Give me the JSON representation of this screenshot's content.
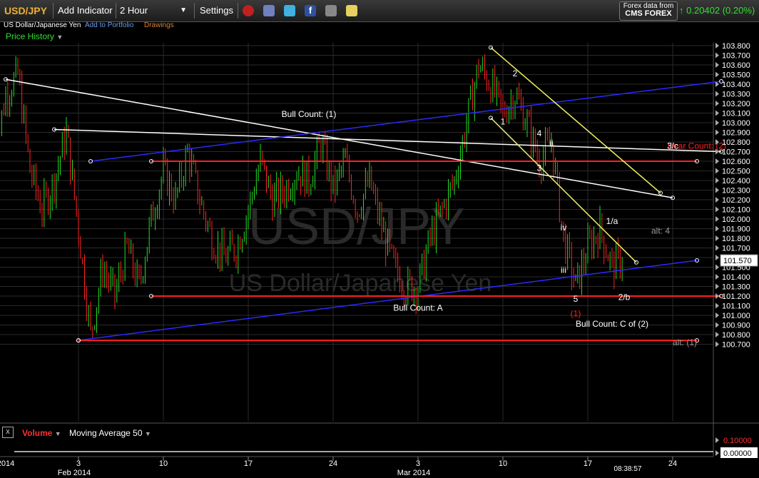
{
  "toolbar": {
    "symbol": "USD/JPY",
    "add_indicator": "Add Indicator",
    "interval": "2 Hour",
    "settings": "Settings",
    "provider_line1": "Forex data from",
    "provider_line2": "CMS FOREX",
    "change": "0.20402 (0.20%)",
    "up_arrow": "↑"
  },
  "subbar": {
    "name": "US Dollar/Japanese Yen",
    "portfolio": "Add to Portfolio",
    "drawings": "Drawings"
  },
  "price_history": "Price History",
  "volume_panel": {
    "close": "x",
    "volume": "Volume",
    "moving_average": "Moving Average 50"
  },
  "colors": {
    "up": "#22dd22",
    "down": "#ff2222",
    "blue_line": "#2a2aff",
    "red_line": "#ff2020",
    "yellow_line": "#f0f060",
    "white_line": "#ffffff",
    "grid": "#2a2a2a"
  },
  "icons": [
    "alarm-clock-icon",
    "cube-icon",
    "twitter-icon",
    "facebook-icon",
    "binoculars-icon",
    "note-icon"
  ],
  "chart_data": {
    "type": "candlestick",
    "watermark_symbol": "USD/JPY",
    "watermark_name": "US Dollar/Japanese Yen",
    "ylim": [
      100.6,
      103.9
    ],
    "y_ticks": [
      "103.800",
      "103.700",
      "103.600",
      "103.500",
      "103.400",
      "103.300",
      "103.200",
      "103.100",
      "103.000",
      "102.900",
      "102.800",
      "102.700",
      "102.600",
      "102.500",
      "102.400",
      "102.300",
      "102.200",
      "102.100",
      "102.000",
      "101.900",
      "101.800",
      "101.700",
      "101.600",
      "101.500",
      "101.400",
      "101.300",
      "101.200",
      "101.100",
      "101.000",
      "100.900",
      "100.800",
      "100.700"
    ],
    "last_price": "101.570",
    "volume_ticks": [
      "0.10000",
      "0.00000"
    ],
    "time_label": "08:38:57",
    "x_ticks": [
      {
        "label": "2014",
        "date": "2014-01-27"
      },
      {
        "label": "3",
        "date": "2014-02-03"
      },
      {
        "label": "10",
        "date": "2014-02-10"
      },
      {
        "label": "17",
        "date": "2014-02-17"
      },
      {
        "label": "24",
        "date": "2014-02-24"
      },
      {
        "label": "3",
        "date": "2014-03-03"
      },
      {
        "label": "10",
        "date": "2014-03-10"
      },
      {
        "label": "17",
        "date": "2014-03-17"
      },
      {
        "label": "24",
        "date": "2014-03-24"
      }
    ],
    "x_month_labels": [
      {
        "label": "Feb 2014",
        "date": "2014-02-03"
      },
      {
        "label": "Mar 2014",
        "date": "2014-03-03"
      }
    ],
    "price_path": [
      [
        "2014-01-27",
        102.6
      ],
      [
        "2014-01-28",
        103.3
      ],
      [
        "2014-01-29",
        103.5
      ],
      [
        "2014-01-30",
        102.5
      ],
      [
        "2014-01-31",
        102.1
      ],
      [
        "2014-02-01",
        102.4
      ],
      [
        "2014-02-02",
        102.9
      ],
      [
        "2014-02-03",
        101.9
      ],
      [
        "2014-02-04",
        100.8
      ],
      [
        "2014-02-05",
        101.5
      ],
      [
        "2014-02-06",
        101.2
      ],
      [
        "2014-02-07",
        101.7
      ],
      [
        "2014-02-08",
        101.3
      ],
      [
        "2014-02-09",
        102.0
      ],
      [
        "2014-02-10",
        102.5
      ],
      [
        "2014-02-11",
        102.2
      ],
      [
        "2014-02-12",
        102.7
      ],
      [
        "2014-02-13",
        102.2
      ],
      [
        "2014-02-14",
        101.8
      ],
      [
        "2014-02-15",
        101.6
      ],
      [
        "2014-02-16",
        101.7
      ],
      [
        "2014-02-17",
        102.1
      ],
      [
        "2014-02-18",
        102.6
      ],
      [
        "2014-02-19",
        102.2
      ],
      [
        "2014-02-20",
        102.3
      ],
      [
        "2014-02-21",
        102.5
      ],
      [
        "2014-02-22",
        102.4
      ],
      [
        "2014-02-23",
        102.8
      ],
      [
        "2014-02-24",
        102.3
      ],
      [
        "2014-02-25",
        102.6
      ],
      [
        "2014-02-26",
        102.1
      ],
      [
        "2014-02-27",
        102.4
      ],
      [
        "2014-02-28",
        101.9
      ],
      [
        "2014-03-01",
        101.5
      ],
      [
        "2014-03-02",
        101.3
      ],
      [
        "2014-03-03",
        101.3
      ],
      [
        "2014-03-04",
        101.8
      ],
      [
        "2014-03-05",
        102.1
      ],
      [
        "2014-03-06",
        102.4
      ],
      [
        "2014-03-07",
        103.0
      ],
      [
        "2014-03-08",
        103.6
      ],
      [
        "2014-03-09",
        103.4
      ],
      [
        "2014-03-10",
        103.1
      ],
      [
        "2014-03-11",
        103.3
      ],
      [
        "2014-03-12",
        103.0
      ],
      [
        "2014-03-13",
        102.6
      ],
      [
        "2014-03-14",
        102.8
      ],
      [
        "2014-03-15",
        101.8
      ],
      [
        "2014-03-16",
        101.3
      ],
      [
        "2014-03-17",
        101.7
      ],
      [
        "2014-03-18",
        101.9
      ],
      [
        "2014-03-19",
        101.5
      ],
      [
        "2014-03-20",
        101.6
      ]
    ],
    "trendlines": [
      {
        "color": "white",
        "start": [
          "2014-01-28",
          103.45
        ],
        "end": [
          "2014-03-24",
          102.22
        ]
      },
      {
        "color": "white",
        "start": [
          "2014-02-01",
          102.93
        ],
        "end": [
          "2014-03-28",
          102.7
        ]
      },
      {
        "color": "blue",
        "start": [
          "2014-02-04",
          102.6
        ],
        "end": [
          "2014-03-28",
          103.43
        ]
      },
      {
        "color": "blue",
        "start": [
          "2014-02-03",
          100.74
        ],
        "end": [
          "2014-03-26",
          101.57
        ]
      },
      {
        "color": "red",
        "start": [
          "2014-02-09",
          102.6
        ],
        "end": [
          "2014-03-26",
          102.6
        ]
      },
      {
        "color": "red",
        "start": [
          "2014-02-09",
          101.2
        ],
        "end": [
          "2014-03-28",
          101.2
        ]
      },
      {
        "color": "red",
        "start": [
          "2014-02-03",
          100.74
        ],
        "end": [
          "2014-03-26",
          100.74
        ]
      },
      {
        "color": "yellow",
        "start": [
          "2014-03-09",
          103.78
        ],
        "end": [
          "2014-03-23",
          102.27
        ]
      },
      {
        "color": "yellow",
        "start": [
          "2014-03-09",
          103.05
        ],
        "end": [
          "2014-03-21",
          101.55
        ]
      }
    ],
    "annotations": [
      {
        "text": "Bull Count: (1)",
        "x": "2014-02-22",
        "y": 103.06,
        "color": "white"
      },
      {
        "text": "Bull Count: A",
        "x": "2014-03-03",
        "y": 101.05,
        "color": "white"
      },
      {
        "text": "Bull Count: C of (2)",
        "x": "2014-03-19",
        "y": 100.88,
        "color": "white"
      },
      {
        "text": "Bear Count: (2)",
        "x": "2014-03-26",
        "y": 102.73,
        "color": "red"
      },
      {
        "text": "3/c",
        "x": "2014-03-24",
        "y": 102.73,
        "color": "white"
      },
      {
        "text": "2",
        "x": "2014-03-11",
        "y": 103.48,
        "color": "white"
      },
      {
        "text": "1",
        "x": "2014-03-10",
        "y": 102.98,
        "color": "white"
      },
      {
        "text": "4",
        "x": "2014-03-13",
        "y": 102.86,
        "color": "white"
      },
      {
        "text": "ii",
        "x": "2014-03-14",
        "y": 102.76,
        "color": "white"
      },
      {
        "text": "3",
        "x": "2014-03-13",
        "y": 102.5,
        "color": "white"
      },
      {
        "text": "1/a",
        "x": "2014-03-19",
        "y": 101.95,
        "color": "white"
      },
      {
        "text": "iv",
        "x": "2014-03-15",
        "y": 101.88,
        "color": "white"
      },
      {
        "text": "iii",
        "x": "2014-03-15",
        "y": 101.44,
        "color": "white"
      },
      {
        "text": "alt: 4",
        "x": "2014-03-23",
        "y": 101.85,
        "color": "gray"
      },
      {
        "text": "5",
        "x": "2014-03-16",
        "y": 101.14,
        "color": "white"
      },
      {
        "text": "(1)",
        "x": "2014-03-16",
        "y": 100.99,
        "color": "red"
      },
      {
        "text": "2/b",
        "x": "2014-03-20",
        "y": 101.16,
        "color": "white"
      },
      {
        "text": "alt: (1)",
        "x": "2014-03-25",
        "y": 100.69,
        "color": "gray"
      }
    ]
  }
}
